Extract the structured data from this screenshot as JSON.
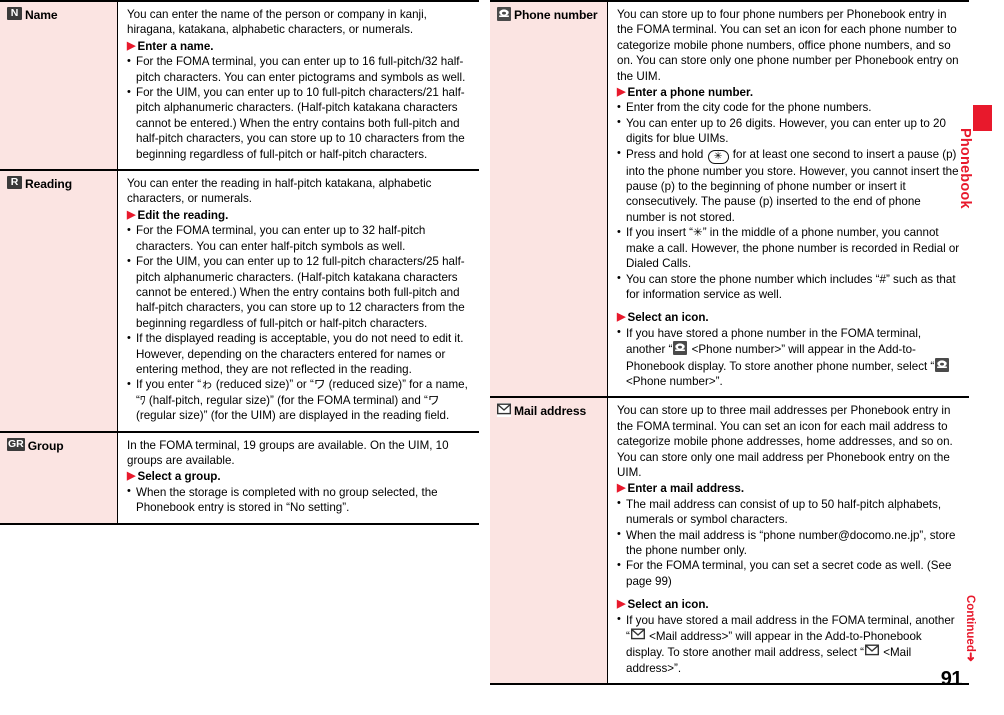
{
  "page": {
    "number": "91",
    "continued_label": "Continued",
    "continued_arrow": "➜",
    "side_tab_label": "Phonebook",
    "accent_color": "#e8192c",
    "label_cell_color": "#fbe4e2"
  },
  "left_column": {
    "rows": [
      {
        "icon": "badge-n-icon",
        "icon_text": "N",
        "label": "Name",
        "lead": "You can enter the name of the person or company in kanji, hiragana, katakana, alphabetic characters, or numerals.",
        "blocks": [
          {
            "step": "Enter a name.",
            "notes": [
              "For the FOMA terminal, you can enter up to 16 full-pitch/32 half-pitch characters. You can enter pictograms and symbols as well.",
              "For the UIM, you can enter up to 10 full-pitch characters/21 half-pitch alphanumeric characters. (Half-pitch katakana characters cannot be entered.) When the entry contains both full-pitch and half-pitch characters, you can store up to 10 characters from the beginning regardless of full-pitch or half-pitch characters."
            ]
          }
        ]
      },
      {
        "icon": "badge-r-icon",
        "icon_text": "R",
        "label": "Reading",
        "lead": "You can enter the reading in half-pitch katakana, alphabetic characters, or numerals.",
        "blocks": [
          {
            "step": "Edit the reading.",
            "notes": [
              "For the FOMA terminal, you can enter up to 32 half-pitch characters. You can enter half-pitch symbols as well.",
              "For the UIM, you can enter up to 12 full-pitch characters/25 half-pitch alphanumeric characters. (Half-pitch katakana characters cannot be entered.) When the entry contains both full-pitch and half-pitch characters, you can store up to 12 characters from the beginning regardless of full-pitch or half-pitch characters.",
              "If the displayed reading is acceptable, you do not need to edit it. However, depending on the characters entered for names or entering method, they are not reflected in the reading.",
              "If you enter “ゎ (reduced size)” or “ワ (reduced size)” for a name, “ﾜ (half-pitch, regular size)” (for the FOMA terminal) and “ワ (regular size)” (for the UIM) are displayed in the reading field."
            ]
          }
        ]
      },
      {
        "icon": "badge-gr-icon",
        "icon_text": "GR",
        "label": "Group",
        "lead": "In the FOMA terminal, 19 groups are available. On the UIM, 10 groups are available.",
        "blocks": [
          {
            "step": "Select a group.",
            "notes": [
              "When the storage is completed with no group selected, the Phonebook entry is stored in “No setting”."
            ]
          }
        ]
      }
    ]
  },
  "right_column": {
    "rows": [
      {
        "icon": "phone-icon",
        "label": "Phone number",
        "lead": "You can store up to four phone numbers per Phonebook entry in the FOMA terminal. You can set an icon for each phone number to categorize mobile phone numbers, office phone numbers, and so on. You can store only one phone number per Phonebook entry on the UIM.",
        "blocks": [
          {
            "step": "Enter a phone number.",
            "notes": [
              "Enter from the city code for the phone numbers.",
              "You can enter up to 26 digits. However, you can enter up to 20 digits for blue UIMs.",
              "Press and hold [KEY] for at least one second to insert a pause (p) into the phone number you store. However, you cannot insert the pause (p) to the beginning of phone number or insert it consecutively. The pause (p) inserted to the end of phone number is not stored.",
              "If you insert “✳” in the middle of a phone number, you cannot make a call. However, the phone number is recorded in Redial or Dialed Calls.",
              "You can store the phone number which includes “#” such as that for information service as well."
            ]
          },
          {
            "step": "Select an icon.",
            "notes": [
              "If you have stored a phone number in the FOMA terminal, another “[ICON] <Phone number>” will appear in the Add-to-Phonebook display. To store another phone number, select “[ICON] <Phone number>”."
            ]
          }
        ]
      },
      {
        "icon": "mail-icon",
        "label": "Mail address",
        "lead": "You can store up to three mail addresses per Phonebook entry in the FOMA terminal. You can set an icon for each mail address to categorize mobile phone addresses, home addresses, and so on. You can store only one mail address per Phonebook entry on the UIM.",
        "blocks": [
          {
            "step": "Enter a mail address.",
            "notes": [
              "The mail address can consist of up to 50 half-pitch alphabets, numerals or symbol characters.",
              "When the mail address is “phone number@docomo.ne.jp”, store the phone number only.",
              "For the FOMA terminal, you can set a secret code as well. (See page 99)"
            ]
          },
          {
            "step": "Select an icon.",
            "notes": [
              "If you have stored a mail address in the FOMA terminal, another “[ICON] <Mail address>” will appear in the Add-to-Phonebook display. To store another mail address, select “[ICON] <Mail address>”."
            ]
          }
        ]
      }
    ]
  },
  "key_glyph": "✳",
  "inline_markers": {
    "key_token": "[KEY]",
    "icon_token": "[ICON]"
  }
}
